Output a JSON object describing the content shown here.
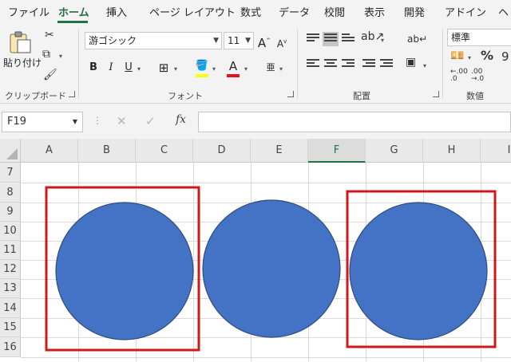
{
  "ribbon": {
    "tabs": [
      "ファイル",
      "ホーム",
      "挿入",
      "ページ レイアウト",
      "数式",
      "データ",
      "校閲",
      "表示",
      "開発",
      "アドイン",
      "ヘ"
    ],
    "clipboard": {
      "paste_label": "貼り付け",
      "group_label": "クリップボード"
    },
    "font": {
      "font_name": "游ゴシック",
      "font_size": "11",
      "grow_label": "A",
      "shrink_label": "A",
      "bold_label": "B",
      "italic_label": "I",
      "underline_label": "U",
      "font_color_label": "A",
      "phonetic_label": "亜",
      "group_label": "フォント"
    },
    "alignment": {
      "group_label": "配置"
    },
    "number": {
      "format": "標準",
      "percent_label": "%",
      "comma_label": "9",
      "increase_decimal": ".00",
      "decrease_decimal": ".00",
      "group_label": "数値"
    }
  },
  "formula_bar": {
    "name_box": "F19",
    "cancel_glyph": "✕",
    "enter_glyph": "✓",
    "fx_label": "fx",
    "formula": ""
  },
  "sheet": {
    "columns": [
      "A",
      "B",
      "C",
      "D",
      "E",
      "F",
      "G",
      "H",
      "I"
    ],
    "selected_column": "F",
    "rows": [
      "7",
      "8",
      "9",
      "10",
      "11",
      "12",
      "13",
      "14",
      "15",
      "16"
    ]
  },
  "colors": {
    "accent": "#217346",
    "shape_fill": "#4472c4",
    "shape_outline": "#2f4e7a",
    "highlight_box": "#d01818"
  }
}
